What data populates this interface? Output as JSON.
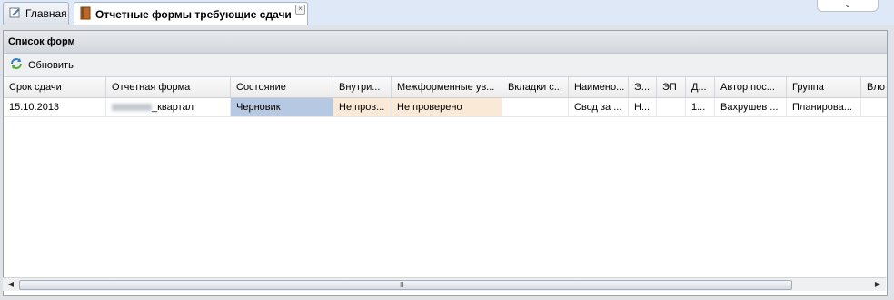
{
  "tabs": [
    {
      "label": "Главная",
      "icon": "edit-icon"
    },
    {
      "label": "Отчетные формы требующие сдачи",
      "icon": "book-icon",
      "closable": true
    }
  ],
  "overflow_chevron": "⌄",
  "panel": {
    "title": "Список форм",
    "refresh_label": "Обновить"
  },
  "grid": {
    "columns": [
      "Срок сдачи",
      "Отчетная форма",
      "Состояние",
      "Внутри...",
      "Межформенные ув...",
      "Вкладки с...",
      "Наимено...",
      "Э...",
      "ЭП",
      "Д...",
      "Автор пос...",
      "Группа",
      "Вло"
    ],
    "rows": [
      [
        "15.10.2013",
        "_квартал",
        "Черновик",
        "Не пров...",
        "Не проверено",
        "",
        "Свод за ...",
        "Н...",
        "",
        "1...",
        "Вахрушев ...",
        "Планирова...",
        ""
      ]
    ]
  },
  "colors": {
    "status_draft_bg": "#b7c9e2",
    "unchecked_bg": "#fbe9d8"
  },
  "scrollbar": {
    "grip": "III"
  }
}
